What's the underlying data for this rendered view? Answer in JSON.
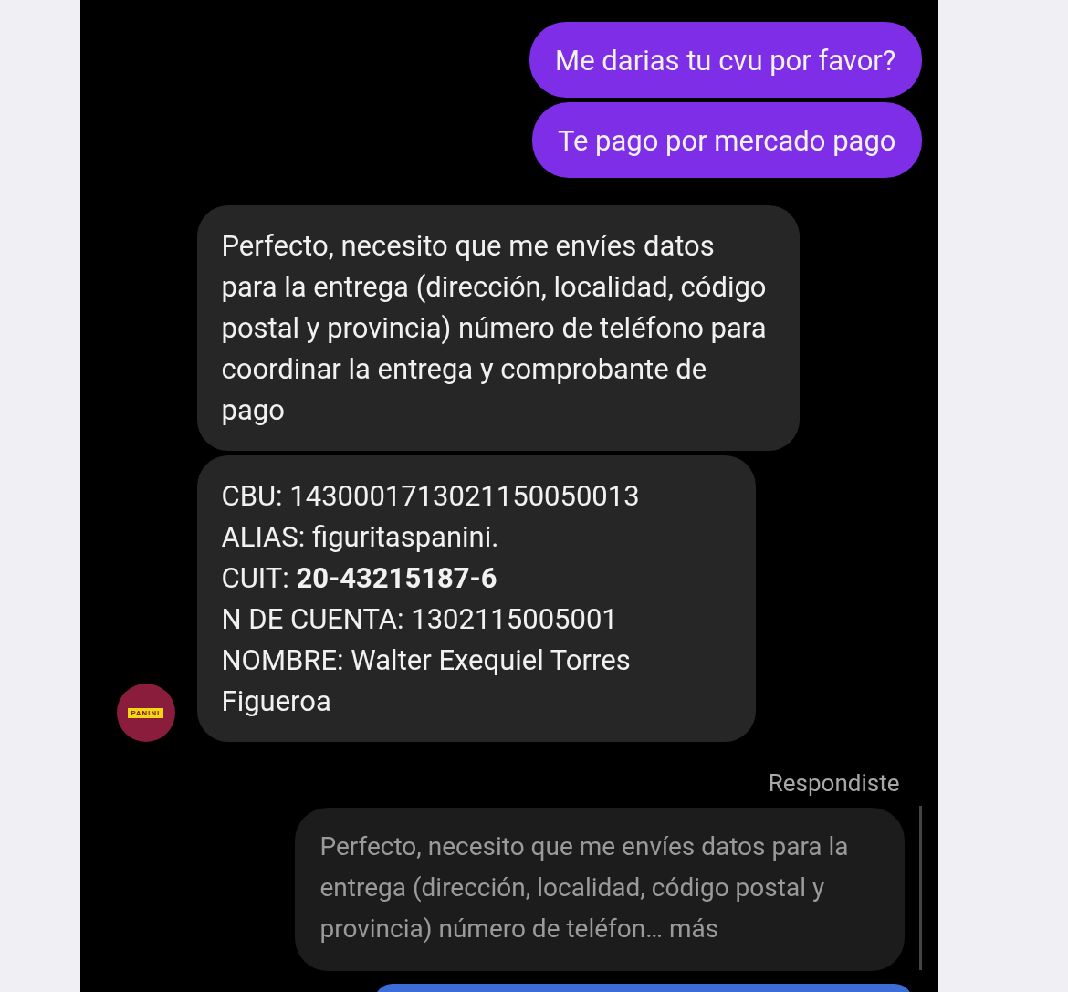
{
  "messages": [
    {
      "kind": "outgoing",
      "text": "Me darias tu cvu por favor?"
    },
    {
      "kind": "outgoing",
      "text": "Te pago por mercado pago"
    },
    {
      "kind": "incoming",
      "text": "Perfecto, necesito que me envíes datos para la entrega (dirección, localidad, código postal y provincia) número de teléfono para coordinar la entrega y comprobante de pago"
    },
    {
      "kind": "incoming_lines",
      "lines": [
        "CBU: 1430001713021150050013",
        "ALIAS: figuritaspanini.",
        "CUIT: **20-43215187-6**",
        "N DE CUENTA: 1302115005001",
        "NOMBRE: Walter Exequiel Torres Figueroa"
      ]
    }
  ],
  "avatar": {
    "label": "PANINI"
  },
  "reply": {
    "caption": "Respondiste",
    "quote": "Perfecto, necesito que me envíes datos para la entrega (dirección, localidad, código postal y provincia) número de teléfon…",
    "more": "más"
  }
}
